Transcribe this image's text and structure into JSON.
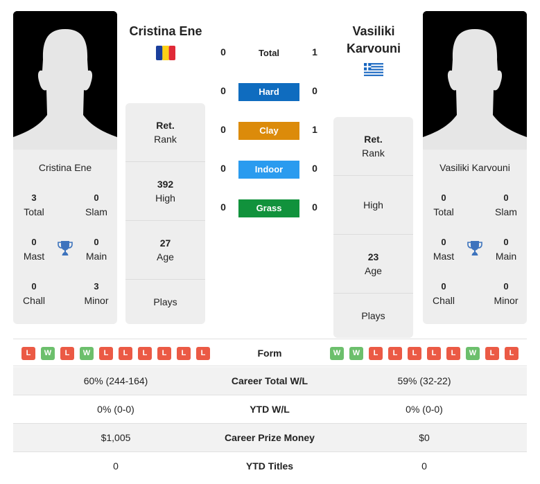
{
  "colors": {
    "hard": "#0f6cbf",
    "clay": "#dc8b0a",
    "indoor": "#2a9bef",
    "grass": "#11923c",
    "loss": "#eb5a45",
    "win": "#6cbf6c",
    "trophy": "#3d73bd"
  },
  "player1": {
    "name": "Cristina Ene",
    "flag": "romania-flag",
    "card_name": "Cristina Ene",
    "titles": {
      "total": "3",
      "total_label": "Total",
      "slam": "0",
      "slam_label": "Slam",
      "mast": "0",
      "mast_label": "Mast",
      "main": "0",
      "main_label": "Main",
      "chall": "0",
      "chall_label": "Chall",
      "minor": "3",
      "minor_label": "Minor"
    },
    "info": {
      "rank_value": "Ret.",
      "rank_label": "Rank",
      "high_value": "392",
      "high_label": "High",
      "age_value": "27",
      "age_label": "Age",
      "plays_label": "Plays"
    },
    "form": [
      "L",
      "W",
      "L",
      "W",
      "L",
      "L",
      "L",
      "L",
      "L",
      "L"
    ]
  },
  "player2": {
    "name_line1": "Vasiliki",
    "name_line2": "Karvouni",
    "flag": "greece-flag",
    "card_name": "Vasiliki Karvouni",
    "titles": {
      "total": "0",
      "total_label": "Total",
      "slam": "0",
      "slam_label": "Slam",
      "mast": "0",
      "mast_label": "Mast",
      "main": "0",
      "main_label": "Main",
      "chall": "0",
      "chall_label": "Chall",
      "minor": "0",
      "minor_label": "Minor"
    },
    "info": {
      "rank_value": "Ret.",
      "rank_label": "Rank",
      "high_label": "High",
      "age_value": "23",
      "age_label": "Age",
      "plays_label": "Plays"
    },
    "form": [
      "W",
      "W",
      "L",
      "L",
      "L",
      "L",
      "L",
      "W",
      "L",
      "L"
    ]
  },
  "h2h": {
    "total": {
      "label": "Total",
      "p1": "0",
      "p2": "1"
    },
    "surfaces": [
      {
        "label": "Hard",
        "p1": "0",
        "p2": "0"
      },
      {
        "label": "Clay",
        "p1": "0",
        "p2": "1"
      },
      {
        "label": "Indoor",
        "p1": "0",
        "p2": "0"
      },
      {
        "label": "Grass",
        "p1": "0",
        "p2": "0"
      }
    ]
  },
  "form_label": "Form",
  "stats": [
    {
      "label": "Career Total W/L",
      "p1": "60% (244-164)",
      "p2": "59% (32-22)"
    },
    {
      "label": "YTD W/L",
      "p1": "0% (0-0)",
      "p2": "0% (0-0)"
    },
    {
      "label": "Career Prize Money",
      "p1": "$1,005",
      "p2": "$0"
    },
    {
      "label": "YTD Titles",
      "p1": "0",
      "p2": "0"
    }
  ]
}
